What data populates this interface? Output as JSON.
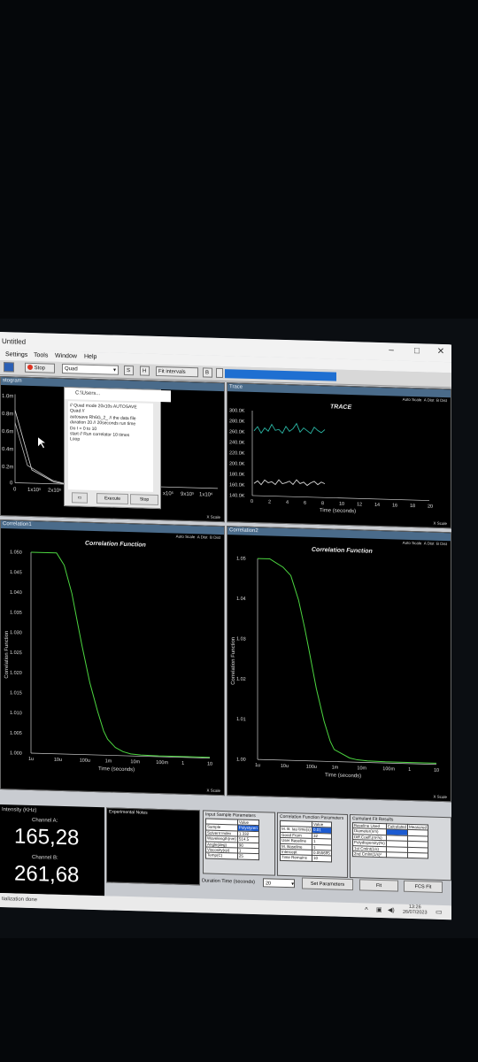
{
  "window": {
    "title": "Untitled"
  },
  "menu": [
    "Settings",
    "Tools",
    "Window",
    "Help"
  ],
  "toolbar": {
    "stop_label": "Stop",
    "mode_value": "Quad",
    "s_label": "S",
    "h_label": "H",
    "fit_interval_label": "Fit intervals",
    "b_label": "B",
    "progress_cells": 14
  },
  "panels": {
    "histogram": {
      "title": "stogram",
      "yticks": [
        "1.0m",
        "0.8m",
        "0.6m",
        "0.4m",
        "0.2m",
        "0"
      ],
      "xticks_left": [
        "0",
        "1x10⁵",
        "2x10⁵"
      ],
      "xticks_right": [
        "x10⁵",
        "9x10⁵",
        "1x10⁶"
      ]
    },
    "trace": {
      "title": "Trace",
      "chart_title": "TRACE",
      "auto_scale": "Auto Scale",
      "a_dist": "A Dist",
      "b_dist": "B Dist",
      "y_scale": "Y Scale",
      "x_scale": "X Scale"
    },
    "corr1": {
      "title": "Correlation1",
      "chart_title": "Correlation Function",
      "auto_scale": "Auto Scale",
      "a_dist": "A Dist",
      "b_dist": "B Dist",
      "y_scale": "Y Scale",
      "x_scale": "X Scale"
    },
    "corr2": {
      "title": "Correlation2",
      "chart_title": "Correlation Function",
      "auto_scale": "Auto Scale",
      "a_dist": "A Dist",
      "b_dist": "B Dist",
      "y_scale": "Y Scale",
      "x_scale": "X Scale"
    }
  },
  "script_window": {
    "title": "C:\\Users...",
    "lines": [
      "// Quad mode 20x10s AUTOSAVE",
      "Quad //",
      "autosave Rh6G_2_ // the data file",
      "duration 20 // 20seconds run time",
      "Do I = 0 to 10",
      "start  // Run correlator 10 times",
      "Loop"
    ],
    "execute_label": "Execute",
    "stop_label": "Stop"
  },
  "chart_data": [
    {
      "type": "line",
      "title": "TRACE",
      "xlabel": "Time (seconds)",
      "ylabel": "",
      "xlim": [
        0,
        20
      ],
      "ylim": [
        140,
        300
      ],
      "yticks": [
        "300.0K",
        "280.0K",
        "260.0K",
        "240.0K",
        "220.0K",
        "200.0K",
        "180.0K",
        "160.0K",
        "140.0K"
      ],
      "xticks": [
        "0",
        "2",
        "4",
        "6",
        "8",
        "10",
        "12",
        "14",
        "16",
        "18",
        "20"
      ],
      "series": [
        {
          "color": "#2bb7a5",
          "x": [
            0.2,
            0.6,
            1,
            1.4,
            1.8,
            2.2,
            2.6,
            3,
            3.4,
            3.8,
            4.2,
            4.6,
            5,
            5.4,
            5.8,
            6.2,
            6.6,
            7,
            7.4,
            7.8,
            8.2
          ],
          "y": [
            262,
            270,
            258,
            268,
            262,
            275,
            264,
            266,
            259,
            272,
            263,
            268,
            278,
            262,
            270,
            265,
            260,
            272,
            266,
            262,
            268
          ]
        },
        {
          "color": "#d8d8d8",
          "x": [
            0.2,
            0.6,
            1,
            1.4,
            1.8,
            2.2,
            2.6,
            3,
            3.4,
            3.8,
            4.2,
            4.6,
            5,
            5.4,
            5.8,
            6.2,
            6.6,
            7,
            7.4,
            7.8,
            8.2
          ],
          "y": [
            163,
            168,
            161,
            170,
            165,
            167,
            162,
            171,
            164,
            166,
            169,
            163,
            172,
            165,
            168,
            162,
            167,
            170,
            164,
            169,
            166
          ]
        }
      ]
    },
    {
      "type": "line",
      "title": "Correlation Function",
      "xlabel": "Time (seconds)",
      "ylabel": "Correlation Function",
      "x_scale": "log",
      "xticks": [
        "1u",
        "10u",
        "100u",
        "1m",
        "10m",
        "100m",
        "1",
        "10"
      ],
      "yticks": [
        "1.050",
        "1.045",
        "1.040",
        "1.035",
        "1.030",
        "1.025",
        "1.020",
        "1.015",
        "1.010",
        "1.005",
        "1.000"
      ],
      "ylim": [
        1.0,
        1.05
      ],
      "series": [
        {
          "color": "#4cd640",
          "x": [
            1e-06,
            3e-06,
            1e-05,
            2e-05,
            4e-05,
            7e-05,
            0.0001,
            0.0002,
            0.0004,
            0.0007,
            0.001,
            0.002,
            0.004,
            0.008,
            0.02,
            0.1,
            1,
            10
          ],
          "y": [
            1.05,
            1.05,
            1.05,
            1.047,
            1.04,
            1.032,
            1.027,
            1.018,
            1.011,
            1.006,
            1.004,
            1.002,
            1.001,
            1.0005,
            1.0003,
            1.0002,
            1.0002,
            1.0002
          ]
        }
      ]
    },
    {
      "type": "line",
      "title": "Correlation Function",
      "xlabel": "Time (seconds)",
      "ylabel": "Correlation Function",
      "x_scale": "log",
      "xticks": [
        "1u",
        "10u",
        "100u",
        "1m",
        "10m",
        "100m",
        "1",
        "10"
      ],
      "yticks": [
        "1.05",
        "1.04",
        "1.03",
        "1.02",
        "1.01",
        "1.00"
      ],
      "ylim": [
        1.0,
        1.05
      ],
      "series": [
        {
          "color": "#4cd640",
          "x": [
            1e-06,
            3e-06,
            1e-05,
            2e-05,
            4e-05,
            7e-05,
            0.0001,
            0.0002,
            0.0004,
            0.0007,
            0.001,
            0.002,
            0.004,
            0.008,
            0.02,
            0.1,
            1,
            10
          ],
          "y": [
            1.05,
            1.05,
            1.048,
            1.046,
            1.04,
            1.033,
            1.028,
            1.018,
            1.01,
            1.005,
            1.003,
            1.002,
            1.001,
            1.0006,
            1.0004,
            1.0003,
            1.0003,
            1.0003
          ]
        }
      ]
    }
  ],
  "intensity": {
    "label": "Intensity (KHz)",
    "channel_a_label": "Channel A:",
    "channel_a_value": "165,28",
    "channel_b_label": "Channel B:",
    "channel_b_value": "261,68"
  },
  "notes": {
    "label": "Experimental Notes"
  },
  "sample_params": {
    "label": "Input Sample Parameters",
    "header": [
      "",
      "Value"
    ],
    "rows": [
      [
        "Sample",
        "Polystyren"
      ],
      [
        "Solvent Index",
        "1.332"
      ],
      [
        "Wavelength(nm)",
        "514.5"
      ],
      [
        "Angle(deg)",
        "90"
      ],
      [
        "Viscosity(cp)",
        "1"
      ],
      [
        "Temp(C)",
        "25"
      ]
    ]
  },
  "cf_params": {
    "label": "Correlation Function Parameters",
    "header": [
      "",
      "Value"
    ],
    "rows": [
      [
        "M. B. tau time(s)",
        "0.01"
      ],
      [
        "Good From",
        "32"
      ],
      [
        "User Baseline",
        "1"
      ],
      [
        "M. Baseline",
        "1"
      ],
      [
        "Intercept",
        "0.055695"
      ],
      [
        "Time Remains",
        "10"
      ]
    ]
  },
  "cumulant": {
    "label": "Cumulant Fit Results",
    "header": [
      "Baseline Used",
      "Calculated",
      "Measured"
    ],
    "rows": [
      [
        "Diameter(nm)",
        "",
        ""
      ],
      [
        "Diff.Coeff.(m²/s)",
        "",
        ""
      ],
      [
        "Polydispersity(%)",
        "",
        ""
      ],
      [
        "1st Cmlnt(1/s)",
        "",
        ""
      ],
      [
        "2nd Cmlnt(1/s)²",
        "",
        ""
      ]
    ]
  },
  "duration": {
    "label": "Duration Time (seconds)",
    "value": "20"
  },
  "buttons": {
    "set_params": "Set Parameters",
    "fit": "Fit",
    "fcs_fit": "FCS Fit"
  },
  "status": {
    "text": "tialization done"
  },
  "taskbar": {
    "time": "13:26",
    "date": "26/07/2023"
  }
}
